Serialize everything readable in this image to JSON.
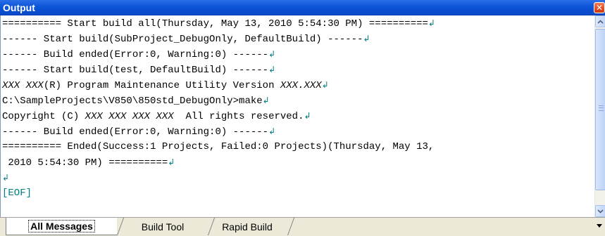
{
  "window": {
    "title": "Output",
    "close_glyph": "✕"
  },
  "output": {
    "lines": [
      {
        "parts": [
          {
            "t": "========== Start build all(Thursday, May 13, 2010 5:54:30 PM) =========="
          }
        ],
        "nl": true
      },
      {
        "parts": [
          {
            "t": "------ Start build(SubProject_DebugOnly, DefaultBuild) ------"
          }
        ],
        "nl": true
      },
      {
        "parts": [
          {
            "t": "------ Build ended(Error:0, Warning:0) ------"
          }
        ],
        "nl": true
      },
      {
        "parts": [
          {
            "t": "------ Start build(test, DefaultBuild) ------"
          }
        ],
        "nl": true
      },
      {
        "parts": [
          {
            "t": "XXX XXX",
            "i": true
          },
          {
            "t": "(R) Program Maintenance Utility Version "
          },
          {
            "t": "XXX.XXX",
            "i": true
          }
        ],
        "nl": true
      },
      {
        "parts": [
          {
            "t": "C:\\SampleProjects\\V850\\850std_DebugOnly>make"
          }
        ],
        "nl": true
      },
      {
        "parts": [
          {
            "t": "Copyright (C) "
          },
          {
            "t": "XXX XXX XXX XXX",
            "i": true
          },
          {
            "t": "  All rights reserved."
          }
        ],
        "nl": true
      },
      {
        "parts": [
          {
            "t": "------ Build ended(Error:0, Warning:0) ------"
          }
        ],
        "nl": true
      },
      {
        "parts": [
          {
            "t": "========== Ended(Success:1 Projects, Failed:0 Projects)(Thursday, May 13,"
          }
        ],
        "nl": false
      },
      {
        "parts": [
          {
            "t": " 2010 5:54:30 PM) =========="
          }
        ],
        "nl": true
      },
      {
        "parts": [],
        "nl": true
      },
      {
        "parts": [
          {
            "t": "[EOF]",
            "c": "eof"
          }
        ],
        "nl": false
      }
    ],
    "newline_glyph": "↲"
  },
  "scrollbar": {
    "up_glyph": "▲",
    "down_glyph": "▼"
  },
  "tabs": [
    {
      "label": "All Messages",
      "active": true
    },
    {
      "label": "Build Tool",
      "active": false
    },
    {
      "label": "Rapid Build",
      "active": false
    }
  ],
  "colors": {
    "title_bar": "#0d55d8",
    "newline_marker": "#008080",
    "tab_bar": "#ece9d8"
  }
}
